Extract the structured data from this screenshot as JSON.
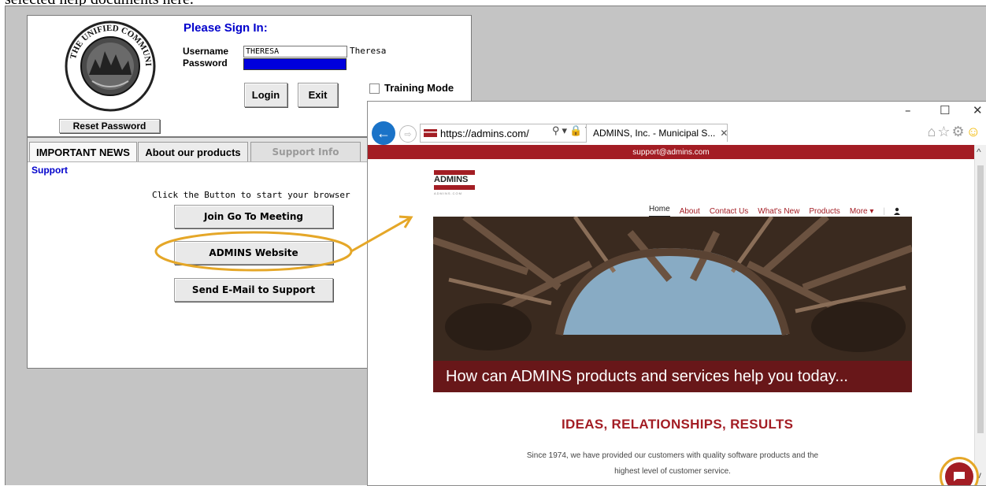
{
  "caption": "selected help documents here.",
  "login": {
    "title": "Please Sign In:",
    "username_label": "Username",
    "password_label": "Password",
    "username_value": "THERESA",
    "display_name": "Theresa",
    "login_button": "Login",
    "exit_button": "Exit",
    "training_mode_label": "Training Mode",
    "reset_password_button": "Reset Password",
    "seal_text": "THE UNIFIED COMMUNITY"
  },
  "tabs": {
    "items": [
      {
        "label": "IMPORTANT NEWS"
      },
      {
        "label": "About our products"
      },
      {
        "label": "Support Info"
      }
    ],
    "support_link": "Support",
    "hint": "Click the Button to start your browser",
    "buttons": {
      "meeting": "Join Go To Meeting",
      "website": "ADMINS Website",
      "email": "Send E-Mail to Support"
    }
  },
  "browser": {
    "url": "https://admins.com/",
    "tab_title": "ADMINS, Inc. - Municipal S...",
    "controls": {
      "minimize": "–",
      "maximize": "☐",
      "close": "✕"
    },
    "icons": [
      "back-icon",
      "forward-icon",
      "search-icon",
      "lock-icon",
      "refresh-icon",
      "home-icon",
      "favorites-icon",
      "settings-icon",
      "smiley-icon"
    ]
  },
  "site": {
    "support_email": "support@admins.com",
    "logo_text": "ADMINS",
    "logo_subtext": "ADMINS.COM",
    "nav": [
      "Home",
      "About",
      "Contact Us",
      "What's New",
      "Products",
      "More ▾"
    ],
    "hero_caption": "How can ADMINS products and services help you today...",
    "headline": "IDEAS, RELATIONSHIPS, RESULTS",
    "intro_line1": "Since 1974, we have provided our customers with quality software products and the",
    "intro_line2": "highest level of customer service.",
    "brand_color": "#a31d24",
    "highlight_color": "#e5a728"
  }
}
